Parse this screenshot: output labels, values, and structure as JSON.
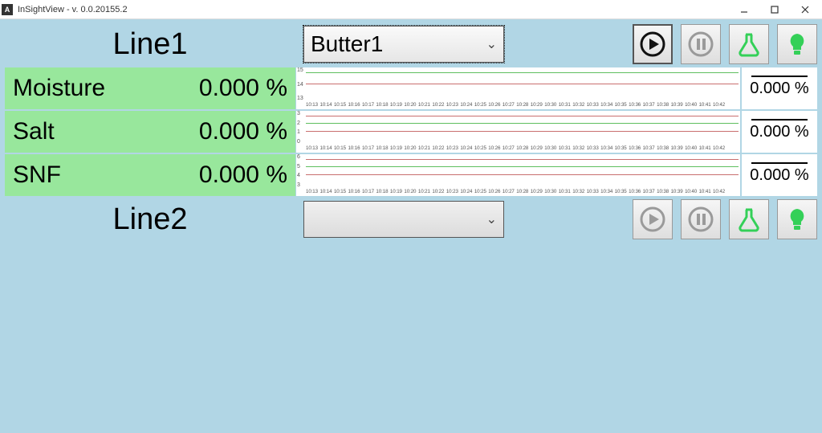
{
  "window": {
    "icon_letter": "A",
    "title": "InSightView - v. 0.0.20155.2"
  },
  "lines": [
    {
      "title": "Line1",
      "product_selected": "Butter1",
      "play_active": true,
      "measurements": [
        {
          "name": "Moisture",
          "value": "0.000 %",
          "avg": "0.000 %",
          "yticks": [
            "15",
            "14",
            "13"
          ],
          "colors": [
            "#5fbf5f",
            "#c96f6f"
          ]
        },
        {
          "name": "Salt",
          "value": "0.000 %",
          "avg": "0.000 %",
          "yticks": [
            "3",
            "2",
            "1",
            "0"
          ],
          "colors": [
            "#c96f6f",
            "#5fbf5f",
            "#c96f6f"
          ]
        },
        {
          "name": "SNF",
          "value": "0.000 %",
          "avg": "0.000 %",
          "yticks": [
            "6",
            "5",
            "4",
            "3"
          ],
          "colors": [
            "#c96f6f",
            "#5fbf5f",
            "#c96f6f"
          ]
        }
      ]
    },
    {
      "title": "Line2",
      "product_selected": "",
      "play_active": false,
      "measurements": []
    }
  ],
  "xaxis_times": [
    "10:13",
    "10:14",
    "10:15",
    "10:16",
    "10:17",
    "10:18",
    "10:19",
    "10:20",
    "10:21",
    "10:22",
    "10:23",
    "10:24",
    "10:25",
    "10:26",
    "10:27",
    "10:28",
    "10:29",
    "10:30",
    "10:31",
    "10:32",
    "10:33",
    "10:34",
    "10:35",
    "10:36",
    "10:37",
    "10:38",
    "10:39",
    "10:40",
    "10:41",
    "10:42"
  ],
  "colors": {
    "flask": "#34d058",
    "bulb": "#34d058",
    "pause_disabled": "#9a9a9a"
  }
}
